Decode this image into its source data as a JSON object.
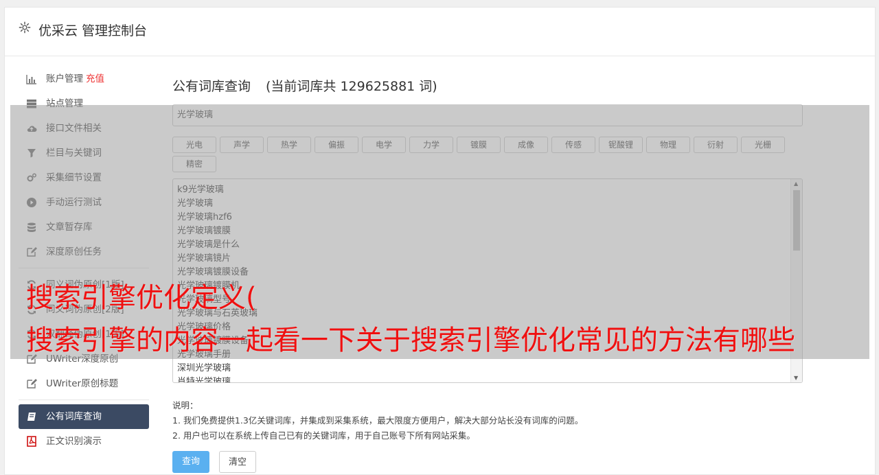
{
  "header": {
    "title": "优采云 管理控制台",
    "icon": "gear-icon"
  },
  "sidebar": {
    "items": [
      {
        "label": "账户管理",
        "extra": "充值",
        "icon": "bar-chart-icon"
      },
      {
        "label": "站点管理",
        "icon": "server-icon"
      },
      {
        "label": "接口文件相关",
        "icon": "cloud-upload-icon"
      },
      {
        "label": "栏目与关键词",
        "icon": "filter-icon"
      },
      {
        "label": "采集细节设置",
        "icon": "gears-icon"
      },
      {
        "label": "手动运行测试",
        "icon": "play-circle-icon"
      },
      {
        "label": "文章暂存库",
        "icon": "database-icon"
      },
      {
        "label": "深度原创任务",
        "icon": "edit-icon"
      }
    ],
    "items2": [
      {
        "label": "同义词伪原创[1版]",
        "icon": "refresh-icon"
      },
      {
        "label": "同义词伪原创[2版]",
        "icon": "refresh-icon"
      },
      {
        "label": "双翻译伪原创[1版]",
        "icon": "refresh-icon"
      },
      {
        "label": "UWriter深度原创",
        "icon": "edit-icon"
      },
      {
        "label": "UWriter原创标题",
        "icon": "edit-icon"
      }
    ],
    "items3": [
      {
        "label": "公有词库查询",
        "icon": "book-icon",
        "active": true
      },
      {
        "label": "正文识别演示",
        "icon": "pdf-icon"
      }
    ]
  },
  "main": {
    "title": "公有词库查询",
    "count_text": "(当前词库共 129625881 词)",
    "search_value": "光学玻璃",
    "chips": [
      "光电",
      "声学",
      "热学",
      "偏振",
      "电学",
      "力学",
      "镀膜",
      "成像",
      "传感",
      "铌酸锂",
      "物理",
      "衍射",
      "光栅",
      "精密"
    ],
    "results": [
      "k9光学玻璃",
      "光学玻璃",
      "光学玻璃hzf6",
      "光学玻璃镀膜",
      "光学玻璃是什么",
      "光学玻璃镜片",
      "光学玻璃镀膜设备",
      "光学玻璃镀膜机",
      "光学玻璃型号",
      "光学玻璃与石英玻璃",
      "光学玻璃价格",
      "光学玻璃镀膜设备",
      "光学玻璃手册",
      "深圳光学玻璃",
      "肖特光学玻璃"
    ],
    "notes_title": "说明：",
    "notes": [
      "1. 我们免费提供1.3亿关键词库，并集成到采集系统，最大限度方便用户，解决大部分站长没有词库的问题。",
      "2. 用户也可以在系统上传自己已有的关键词库，用于自己账号下所有网站采集。"
    ],
    "query_button": "查询",
    "clear_button": "清空"
  },
  "overlay": {
    "line1": "搜索引擎优化定义(",
    "line2": "搜索引擎的内容一起看一下关于搜索引擎优化常见的方法有哪些",
    "color": "#f01010"
  }
}
